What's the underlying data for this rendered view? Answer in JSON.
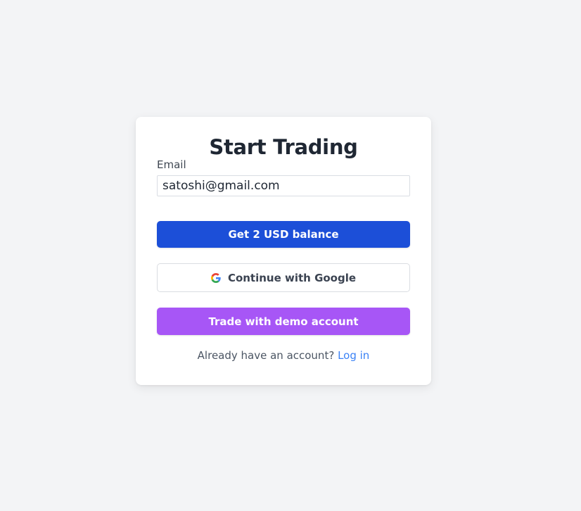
{
  "card": {
    "title": "Start Trading",
    "email_label": "Email",
    "email_value": "satoshi@gmail.com",
    "balance_button": "Get 2 USD balance",
    "google_button": "Continue with Google",
    "demo_button": "Trade with demo account",
    "footer_text": "Already have an account?",
    "login_link": "Log in"
  },
  "icons": {
    "google": "google-logo-icon"
  },
  "colors": {
    "background": "#f3f4f6",
    "primary_button": "#1c4fd8",
    "demo_button": "#a756f6",
    "link": "#3b82f6",
    "title": "#1f2733"
  }
}
